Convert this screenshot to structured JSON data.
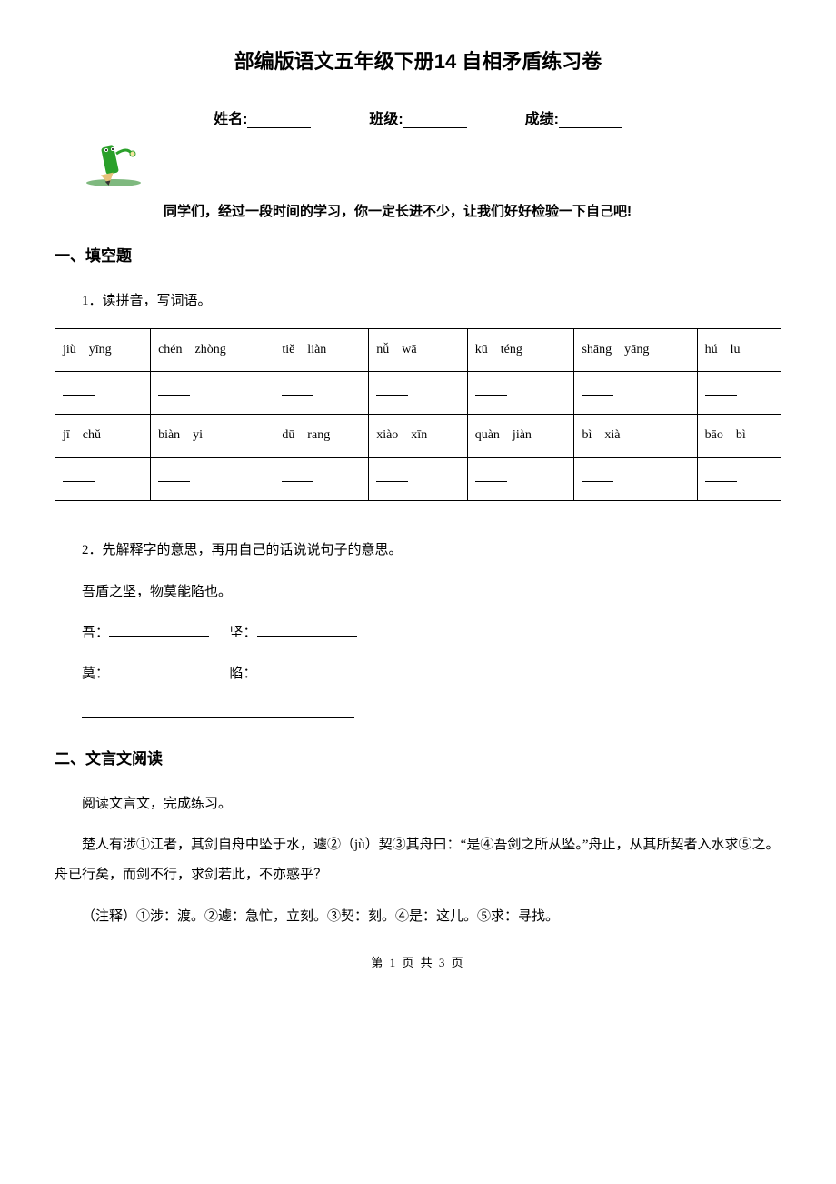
{
  "title": "部编版语文五年级下册14 自相矛盾练习卷",
  "info": {
    "name_label": "姓名:",
    "class_label": "班级:",
    "score_label": "成绩:"
  },
  "intro": "同学们，经过一段时间的学习，你一定长进不少，让我们好好检验一下自己吧!",
  "section1": {
    "heading": "一、填空题",
    "q1_label": "1．读拼音，写词语。",
    "table": {
      "row1": [
        "jiù　yīng",
        "chén　zhòng",
        "tiě　liàn",
        "nǚ　wā",
        "kū　téng",
        "shāng　yāng",
        "hú　lu"
      ],
      "row3": [
        "jī　chǔ",
        "biàn　yi",
        "dū　rang",
        "xiào　xīn",
        "quàn　jiàn",
        "bì　xià",
        "bāo　bì"
      ]
    },
    "q2_label": "2．先解释字的意思，再用自己的话说说句子的意思。",
    "q2_sentence": "吾盾之坚，物莫能陷也。",
    "q2_items": {
      "wu": "吾：",
      "jian": "坚：",
      "mo": "莫：",
      "xian": "陷："
    }
  },
  "section2": {
    "heading": "二、文言文阅读",
    "lead": "阅读文言文，完成练习。",
    "passage": "楚人有涉①江者，其剑自舟中坠于水，遽②（jù）契③其舟曰：“是④吾剑之所从坠。”舟止，从其所契者入水求⑤之。舟已行矣，而剑不行，求剑若此，不亦惑乎？",
    "notes": "（注释）①涉：渡。②遽：急忙，立刻。③契：刻。④是：这儿。⑤求：寻找。"
  },
  "footer": "第 1 页 共 3 页"
}
